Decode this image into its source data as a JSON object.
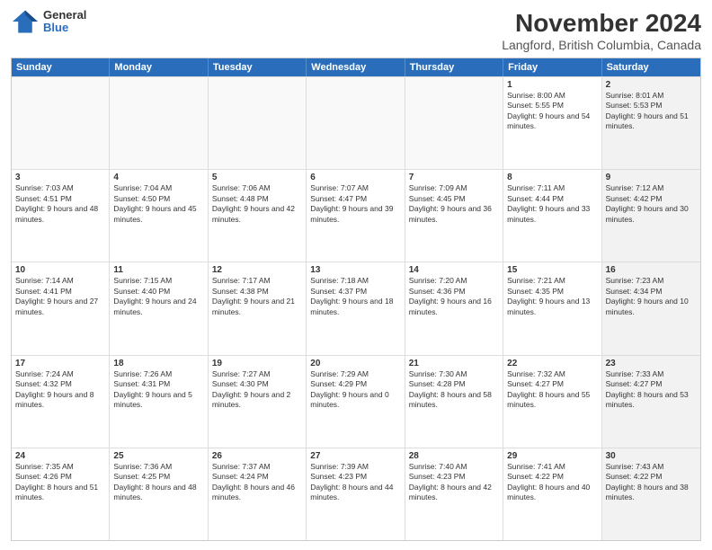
{
  "logo": {
    "general": "General",
    "blue": "Blue"
  },
  "title": "November 2024",
  "subtitle": "Langford, British Columbia, Canada",
  "days": [
    "Sunday",
    "Monday",
    "Tuesday",
    "Wednesday",
    "Thursday",
    "Friday",
    "Saturday"
  ],
  "rows": [
    [
      {
        "date": "",
        "info": "",
        "empty": true
      },
      {
        "date": "",
        "info": "",
        "empty": true
      },
      {
        "date": "",
        "info": "",
        "empty": true
      },
      {
        "date": "",
        "info": "",
        "empty": true
      },
      {
        "date": "",
        "info": "",
        "empty": true
      },
      {
        "date": "1",
        "info": "Sunrise: 8:00 AM\nSunset: 5:55 PM\nDaylight: 9 hours and 54 minutes.",
        "empty": false,
        "shaded": false
      },
      {
        "date": "2",
        "info": "Sunrise: 8:01 AM\nSunset: 5:53 PM\nDaylight: 9 hours and 51 minutes.",
        "empty": false,
        "shaded": true
      }
    ],
    [
      {
        "date": "3",
        "info": "Sunrise: 7:03 AM\nSunset: 4:51 PM\nDaylight: 9 hours and 48 minutes.",
        "empty": false,
        "shaded": false
      },
      {
        "date": "4",
        "info": "Sunrise: 7:04 AM\nSunset: 4:50 PM\nDaylight: 9 hours and 45 minutes.",
        "empty": false,
        "shaded": false
      },
      {
        "date": "5",
        "info": "Sunrise: 7:06 AM\nSunset: 4:48 PM\nDaylight: 9 hours and 42 minutes.",
        "empty": false,
        "shaded": false
      },
      {
        "date": "6",
        "info": "Sunrise: 7:07 AM\nSunset: 4:47 PM\nDaylight: 9 hours and 39 minutes.",
        "empty": false,
        "shaded": false
      },
      {
        "date": "7",
        "info": "Sunrise: 7:09 AM\nSunset: 4:45 PM\nDaylight: 9 hours and 36 minutes.",
        "empty": false,
        "shaded": false
      },
      {
        "date": "8",
        "info": "Sunrise: 7:11 AM\nSunset: 4:44 PM\nDaylight: 9 hours and 33 minutes.",
        "empty": false,
        "shaded": false
      },
      {
        "date": "9",
        "info": "Sunrise: 7:12 AM\nSunset: 4:42 PM\nDaylight: 9 hours and 30 minutes.",
        "empty": false,
        "shaded": true
      }
    ],
    [
      {
        "date": "10",
        "info": "Sunrise: 7:14 AM\nSunset: 4:41 PM\nDaylight: 9 hours and 27 minutes.",
        "empty": false,
        "shaded": false
      },
      {
        "date": "11",
        "info": "Sunrise: 7:15 AM\nSunset: 4:40 PM\nDaylight: 9 hours and 24 minutes.",
        "empty": false,
        "shaded": false
      },
      {
        "date": "12",
        "info": "Sunrise: 7:17 AM\nSunset: 4:38 PM\nDaylight: 9 hours and 21 minutes.",
        "empty": false,
        "shaded": false
      },
      {
        "date": "13",
        "info": "Sunrise: 7:18 AM\nSunset: 4:37 PM\nDaylight: 9 hours and 18 minutes.",
        "empty": false,
        "shaded": false
      },
      {
        "date": "14",
        "info": "Sunrise: 7:20 AM\nSunset: 4:36 PM\nDaylight: 9 hours and 16 minutes.",
        "empty": false,
        "shaded": false
      },
      {
        "date": "15",
        "info": "Sunrise: 7:21 AM\nSunset: 4:35 PM\nDaylight: 9 hours and 13 minutes.",
        "empty": false,
        "shaded": false
      },
      {
        "date": "16",
        "info": "Sunrise: 7:23 AM\nSunset: 4:34 PM\nDaylight: 9 hours and 10 minutes.",
        "empty": false,
        "shaded": true
      }
    ],
    [
      {
        "date": "17",
        "info": "Sunrise: 7:24 AM\nSunset: 4:32 PM\nDaylight: 9 hours and 8 minutes.",
        "empty": false,
        "shaded": false
      },
      {
        "date": "18",
        "info": "Sunrise: 7:26 AM\nSunset: 4:31 PM\nDaylight: 9 hours and 5 minutes.",
        "empty": false,
        "shaded": false
      },
      {
        "date": "19",
        "info": "Sunrise: 7:27 AM\nSunset: 4:30 PM\nDaylight: 9 hours and 2 minutes.",
        "empty": false,
        "shaded": false
      },
      {
        "date": "20",
        "info": "Sunrise: 7:29 AM\nSunset: 4:29 PM\nDaylight: 9 hours and 0 minutes.",
        "empty": false,
        "shaded": false
      },
      {
        "date": "21",
        "info": "Sunrise: 7:30 AM\nSunset: 4:28 PM\nDaylight: 8 hours and 58 minutes.",
        "empty": false,
        "shaded": false
      },
      {
        "date": "22",
        "info": "Sunrise: 7:32 AM\nSunset: 4:27 PM\nDaylight: 8 hours and 55 minutes.",
        "empty": false,
        "shaded": false
      },
      {
        "date": "23",
        "info": "Sunrise: 7:33 AM\nSunset: 4:27 PM\nDaylight: 8 hours and 53 minutes.",
        "empty": false,
        "shaded": true
      }
    ],
    [
      {
        "date": "24",
        "info": "Sunrise: 7:35 AM\nSunset: 4:26 PM\nDaylight: 8 hours and 51 minutes.",
        "empty": false,
        "shaded": false
      },
      {
        "date": "25",
        "info": "Sunrise: 7:36 AM\nSunset: 4:25 PM\nDaylight: 8 hours and 48 minutes.",
        "empty": false,
        "shaded": false
      },
      {
        "date": "26",
        "info": "Sunrise: 7:37 AM\nSunset: 4:24 PM\nDaylight: 8 hours and 46 minutes.",
        "empty": false,
        "shaded": false
      },
      {
        "date": "27",
        "info": "Sunrise: 7:39 AM\nSunset: 4:23 PM\nDaylight: 8 hours and 44 minutes.",
        "empty": false,
        "shaded": false
      },
      {
        "date": "28",
        "info": "Sunrise: 7:40 AM\nSunset: 4:23 PM\nDaylight: 8 hours and 42 minutes.",
        "empty": false,
        "shaded": false
      },
      {
        "date": "29",
        "info": "Sunrise: 7:41 AM\nSunset: 4:22 PM\nDaylight: 8 hours and 40 minutes.",
        "empty": false,
        "shaded": false
      },
      {
        "date": "30",
        "info": "Sunrise: 7:43 AM\nSunset: 4:22 PM\nDaylight: 8 hours and 38 minutes.",
        "empty": false,
        "shaded": true
      }
    ]
  ]
}
